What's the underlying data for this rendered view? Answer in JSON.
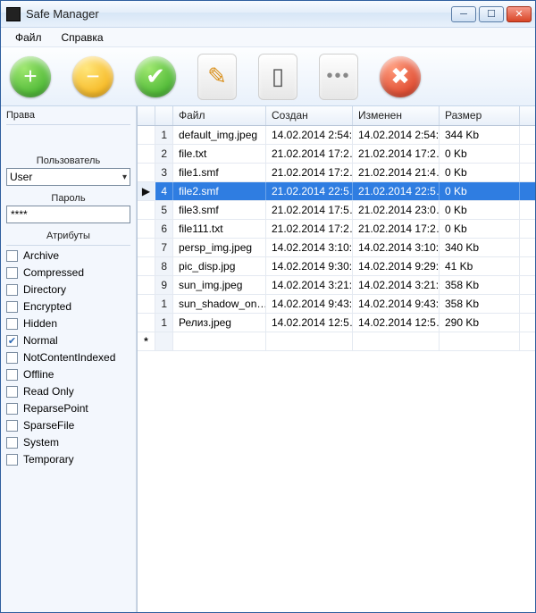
{
  "window": {
    "title": "Safe Manager"
  },
  "menubar": {
    "file": "Файл",
    "help": "Справка"
  },
  "toolbar": {
    "add_sym": "+",
    "remove_sym": "−",
    "apply_sym": "✔",
    "edit_sym": "✎",
    "doc_sym": "▯",
    "more_sym": "•••",
    "cancel_sym": "✖"
  },
  "left": {
    "rights_label": "Права",
    "user_label": "Пользователь",
    "user_value": "User",
    "password_label": "Пароль",
    "password_value": "****",
    "attributes_label": "Атрибуты",
    "attrs": [
      {
        "label": "Archive",
        "checked": false
      },
      {
        "label": "Compressed",
        "checked": false
      },
      {
        "label": "Directory",
        "checked": false
      },
      {
        "label": "Encrypted",
        "checked": false
      },
      {
        "label": "Hidden",
        "checked": false
      },
      {
        "label": "Normal",
        "checked": true
      },
      {
        "label": "NotContentIndexed",
        "checked": false
      },
      {
        "label": "Offline",
        "checked": false
      },
      {
        "label": "Read Only",
        "checked": false
      },
      {
        "label": "ReparsePoint",
        "checked": false
      },
      {
        "label": "SparseFile",
        "checked": false
      },
      {
        "label": "System",
        "checked": false
      },
      {
        "label": "Temporary",
        "checked": false
      }
    ]
  },
  "grid": {
    "headers": {
      "marker": "",
      "index": "",
      "file": "Файл",
      "created": "Создан",
      "modified": "Изменен",
      "size": "Размер"
    },
    "rows": [
      {
        "idx": "1",
        "file": "default_img.jpeg",
        "created": "14.02.2014 2:54:…",
        "modified": "14.02.2014 2:54:…",
        "size": "344 Kb",
        "selected": false
      },
      {
        "idx": "2",
        "file": "file.txt",
        "created": "21.02.2014 17:2…",
        "modified": "21.02.2014 17:2…",
        "size": "0 Kb",
        "selected": false
      },
      {
        "idx": "3",
        "file": "file1.smf",
        "created": "21.02.2014 17:2…",
        "modified": "21.02.2014 21:4…",
        "size": "0 Kb",
        "selected": false
      },
      {
        "idx": "4",
        "file": "file2.smf",
        "created": "21.02.2014 22:5…",
        "modified": "21.02.2014 22:5…",
        "size": "0 Kb",
        "selected": true
      },
      {
        "idx": "5",
        "file": "file3.smf",
        "created": "21.02.2014 17:5…",
        "modified": "21.02.2014 23:0…",
        "size": "0 Kb",
        "selected": false
      },
      {
        "idx": "6",
        "file": "file111.txt",
        "created": "21.02.2014 17:2…",
        "modified": "21.02.2014 17:2…",
        "size": "0 Kb",
        "selected": false
      },
      {
        "idx": "7",
        "file": "persp_img.jpeg",
        "created": "14.02.2014 3:10:…",
        "modified": "14.02.2014 3:10:…",
        "size": "340 Kb",
        "selected": false
      },
      {
        "idx": "8",
        "file": "pic_disp.jpg",
        "created": "14.02.2014 9:30:…",
        "modified": "14.02.2014 9:29:…",
        "size": "41 Kb",
        "selected": false
      },
      {
        "idx": "9",
        "file": "sun_img.jpeg",
        "created": "14.02.2014 3:21:…",
        "modified": "14.02.2014 3:21:…",
        "size": "358 Kb",
        "selected": false
      },
      {
        "idx": "1",
        "file": "sun_shadow_on…",
        "created": "14.02.2014 9:43:…",
        "modified": "14.02.2014 9:43:…",
        "size": "358 Kb",
        "selected": false
      },
      {
        "idx": "1",
        "file": "Релиз.jpeg",
        "created": "14.02.2014 12:5…",
        "modified": "14.02.2014 12:5…",
        "size": "290 Kb",
        "selected": false
      }
    ],
    "new_row_marker": "*"
  }
}
